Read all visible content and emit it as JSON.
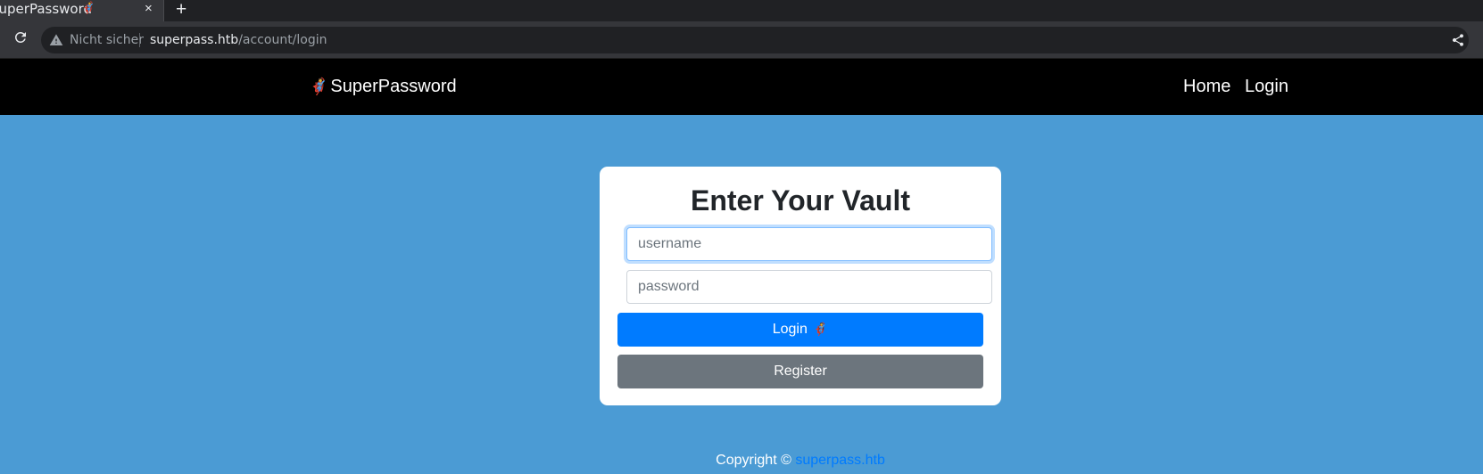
{
  "browser": {
    "tab_title": "SuperPassword",
    "tab_favicon": "🦸",
    "tab_close": "×",
    "new_tab": "+",
    "security_label": "Nicht sicher",
    "url_host": "superpass.htb",
    "url_path": "/account/login"
  },
  "navbar": {
    "brand_icon": "🦸",
    "brand": "SuperPassword",
    "links": [
      "Home",
      "Login"
    ]
  },
  "login": {
    "title": "Enter Your Vault",
    "username_placeholder": "username",
    "password_placeholder": "password",
    "login_label": "Login",
    "login_icon": "🦸",
    "register_label": "Register"
  },
  "footer": {
    "copyright": "Copyright ©",
    "link_text": "superpass.htb"
  },
  "colors": {
    "page_bg": "#4b9bd4",
    "navbar_bg": "#000000",
    "primary": "#007bff",
    "secondary": "#6c757d"
  }
}
